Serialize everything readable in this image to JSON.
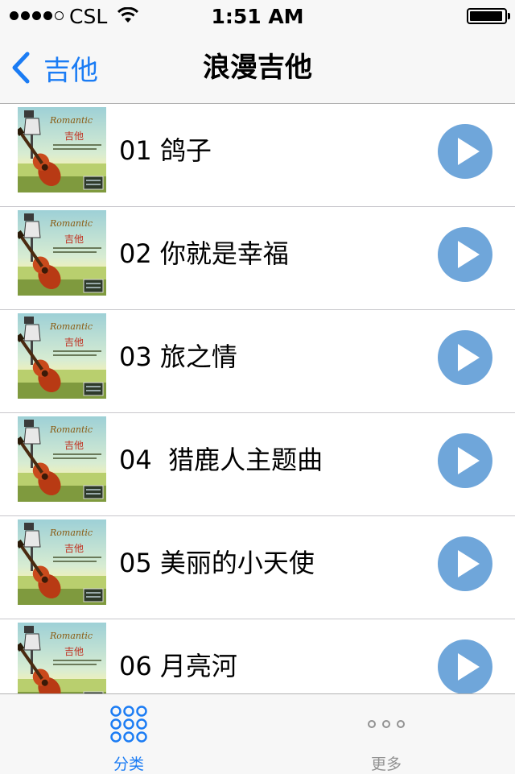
{
  "status_bar": {
    "carrier": "CSL",
    "time": "1:51 AM",
    "signal_bars_filled": 4,
    "signal_bars_total": 5,
    "battery_level": 0.95,
    "icons": [
      "wifi-icon",
      "battery-icon"
    ]
  },
  "nav": {
    "back_label": "吉他",
    "title": "浪漫吉他",
    "back_icon": "chevron-left-icon",
    "accent_color": "#1b7cf4"
  },
  "songs": [
    {
      "title": "01 鸽子"
    },
    {
      "title": "02 你就是幸福"
    },
    {
      "title": "03 旅之情"
    },
    {
      "title": "04  猎鹿人主题曲"
    },
    {
      "title": "05 美丽的小天使"
    },
    {
      "title": "06 月亮河"
    }
  ],
  "song_row_icons": {
    "cover": "album-cover-image",
    "play": "play-icon",
    "play_color": "#6fa6da"
  },
  "tab_bar": {
    "tabs": [
      {
        "label": "分类",
        "icon": "grid-dots-icon",
        "selected": true
      },
      {
        "label": "更多",
        "icon": "more-dots-icon",
        "selected": false
      }
    ],
    "selected_color": "#1b7cf4",
    "unselected_color": "#929292"
  }
}
